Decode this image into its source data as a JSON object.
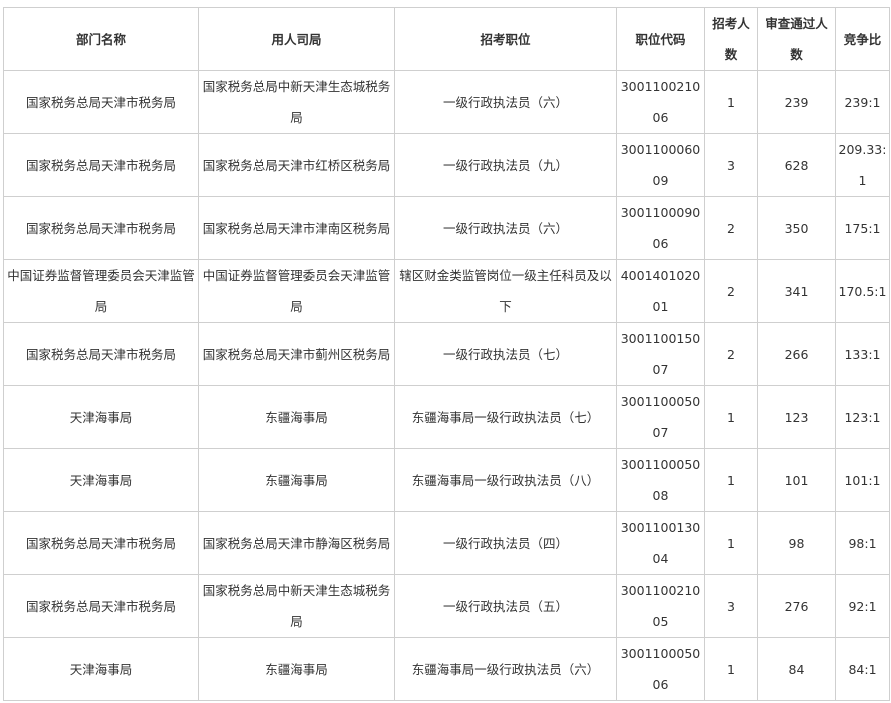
{
  "table": {
    "headers": [
      "部门名称",
      "用人司局",
      "招考职位",
      "职位代码",
      "招考人数",
      "审查通过人数",
      "竞争比"
    ],
    "rows": [
      {
        "dept": "国家税务总局天津市税务局",
        "bureau": "国家税务总局中新天津生态城税务局",
        "position": "一级行政执法员（六）",
        "code": "300110021006",
        "quota": "1",
        "passed": "239",
        "ratio": "239:1"
      },
      {
        "dept": "国家税务总局天津市税务局",
        "bureau": "国家税务总局天津市红桥区税务局",
        "position": "一级行政执法员（九）",
        "code": "300110006009",
        "quota": "3",
        "passed": "628",
        "ratio": "209.33:1"
      },
      {
        "dept": "国家税务总局天津市税务局",
        "bureau": "国家税务总局天津市津南区税务局",
        "position": "一级行政执法员（六）",
        "code": "300110009006",
        "quota": "2",
        "passed": "350",
        "ratio": "175:1"
      },
      {
        "dept": "中国证券监督管理委员会天津监管局",
        "bureau": "中国证券监督管理委员会天津监管局",
        "position": "辖区财金类监管岗位一级主任科员及以下",
        "code": "400140102001",
        "quota": "2",
        "passed": "341",
        "ratio": "170.5:1"
      },
      {
        "dept": "国家税务总局天津市税务局",
        "bureau": "国家税务总局天津市蓟州区税务局",
        "position": "一级行政执法员（七）",
        "code": "300110015007",
        "quota": "2",
        "passed": "266",
        "ratio": "133:1"
      },
      {
        "dept": "天津海事局",
        "bureau": "东疆海事局",
        "position": "东疆海事局一级行政执法员（七）",
        "code": "300110005007",
        "quota": "1",
        "passed": "123",
        "ratio": "123:1"
      },
      {
        "dept": "天津海事局",
        "bureau": "东疆海事局",
        "position": "东疆海事局一级行政执法员（八）",
        "code": "300110005008",
        "quota": "1",
        "passed": "101",
        "ratio": "101:1"
      },
      {
        "dept": "国家税务总局天津市税务局",
        "bureau": "国家税务总局天津市静海区税务局",
        "position": "一级行政执法员（四）",
        "code": "300110013004",
        "quota": "1",
        "passed": "98",
        "ratio": "98:1"
      },
      {
        "dept": "国家税务总局天津市税务局",
        "bureau": "国家税务总局中新天津生态城税务局",
        "position": "一级行政执法员（五）",
        "code": "300110021005",
        "quota": "3",
        "passed": "276",
        "ratio": "92:1"
      },
      {
        "dept": "天津海事局",
        "bureau": "东疆海事局",
        "position": "东疆海事局一级行政执法员（六）",
        "code": "300110005006",
        "quota": "1",
        "passed": "84",
        "ratio": "84:1"
      }
    ]
  }
}
